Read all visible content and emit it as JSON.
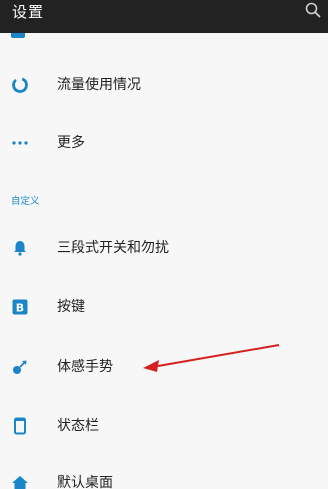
{
  "header": {
    "title": "设置",
    "search_icon": "search-icon"
  },
  "accent_color": "#1a86c8",
  "annotation_arrow_color": "#d42020",
  "items_top": [
    {
      "key": "data-usage",
      "label": "流量使用情况",
      "icon": "data-usage-ring-icon"
    },
    {
      "key": "more",
      "label": "更多",
      "icon": "more-dots-icon"
    }
  ],
  "section_custom": {
    "header": "自定义",
    "items": [
      {
        "key": "alert-slider",
        "label": "三段式开关和勿扰",
        "icon": "bell-icon"
      },
      {
        "key": "buttons",
        "label": "按键",
        "icon": "b-key-icon"
      },
      {
        "key": "gestures",
        "label": "体感手势",
        "icon": "gesture-icon"
      },
      {
        "key": "status-bar",
        "label": "状态栏",
        "icon": "phone-outline-icon"
      },
      {
        "key": "default-launcher",
        "label": "默认桌面",
        "icon": "home-icon"
      }
    ]
  }
}
